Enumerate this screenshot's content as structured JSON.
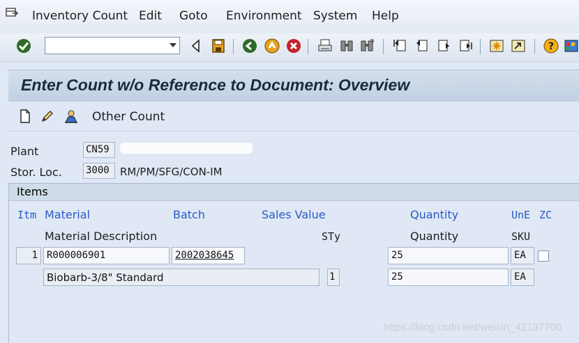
{
  "menu": {
    "items": [
      "Inventory Count",
      "Edit",
      "Goto",
      "Environment",
      "System",
      "Help"
    ]
  },
  "toolbar": {
    "command_field_value": "",
    "icons": [
      "enter-icon",
      "back-triangle-icon",
      "save-icon",
      "back-icon",
      "exit-icon",
      "cancel-icon",
      "print-icon",
      "find-icon",
      "find-next-icon",
      "first-page-icon",
      "previous-page-icon",
      "next-page-icon",
      "last-page-icon",
      "create-session-icon",
      "shortcut-icon",
      "help-icon",
      "customize-layout-icon"
    ]
  },
  "screen": {
    "title": "Enter Count w/o Reference to Document: Overview"
  },
  "app_toolbar": {
    "other_count_label": "Other Count"
  },
  "header": {
    "plant_label": "Plant",
    "plant_value": "CN59",
    "stor_loc_label": "Stor. Loc.",
    "stor_loc_value": "3000",
    "stor_loc_desc": "RM/PM/SFG/CON-IM"
  },
  "items": {
    "title": "Items",
    "columns_row1": {
      "itm": "Itm",
      "material": "Material",
      "batch": "Batch",
      "sales_value": "Sales Value",
      "quantity": "Quantity",
      "une": "UnE",
      "zc": "ZC"
    },
    "columns_row2": {
      "material_description": "Material Description",
      "sty": "STy",
      "quantity": "Quantity",
      "sku": "SKU"
    },
    "rows": [
      {
        "itm": "1",
        "material": "R000006901",
        "batch": "2002038645",
        "quantity": "25",
        "une": "EA",
        "material_description": "Biobarb-3/8\" Standard",
        "sty": "1",
        "quantity_sku": "25",
        "sku": "EA"
      }
    ]
  },
  "watermark": "https://blog.csdn.net/weixin_42137700"
}
